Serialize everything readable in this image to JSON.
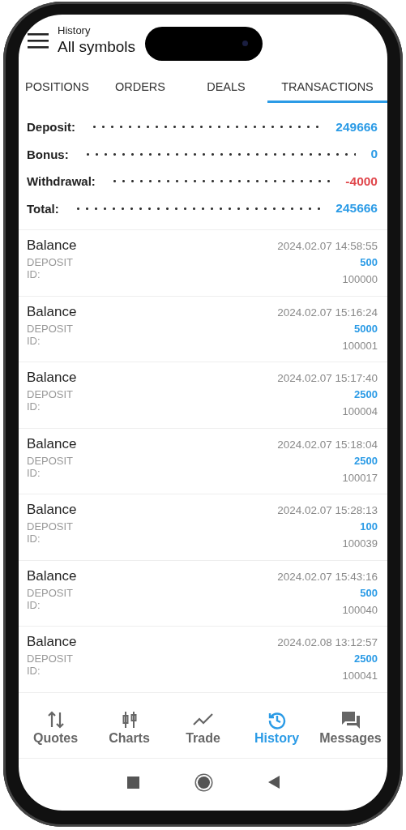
{
  "header": {
    "subtitle": "History",
    "title": "All symbols"
  },
  "tabs": [
    {
      "label": "POSITIONS",
      "selected": false
    },
    {
      "label": "ORDERS",
      "selected": false
    },
    {
      "label": "DEALS",
      "selected": false
    },
    {
      "label": "TRANSACTIONS",
      "selected": true
    }
  ],
  "summary": [
    {
      "label": "Deposit:",
      "value": "249666",
      "color": "#2b9be6"
    },
    {
      "label": "Bonus:",
      "value": "0",
      "color": "#2b9be6"
    },
    {
      "label": "Withdrawal:",
      "value": "-4000",
      "color": "#e0474c"
    },
    {
      "label": "Total:",
      "value": "245666",
      "color": "#2b9be6"
    }
  ],
  "transactions": [
    {
      "symbol": "Balance",
      "time": "2024.02.07 14:58:55",
      "type": "DEPOSIT",
      "amount": "500",
      "id_label": "ID:",
      "id": "100000"
    },
    {
      "symbol": "Balance",
      "time": "2024.02.07 15:16:24",
      "type": "DEPOSIT",
      "amount": "5000",
      "id_label": "ID:",
      "id": "100001"
    },
    {
      "symbol": "Balance",
      "time": "2024.02.07 15:17:40",
      "type": "DEPOSIT",
      "amount": "2500",
      "id_label": "ID:",
      "id": "100004"
    },
    {
      "symbol": "Balance",
      "time": "2024.02.07 15:18:04",
      "type": "DEPOSIT",
      "amount": "2500",
      "id_label": "ID:",
      "id": "100017"
    },
    {
      "symbol": "Balance",
      "time": "2024.02.07 15:28:13",
      "type": "DEPOSIT",
      "amount": "100",
      "id_label": "ID:",
      "id": "100039"
    },
    {
      "symbol": "Balance",
      "time": "2024.02.07 15:43:16",
      "type": "DEPOSIT",
      "amount": "500",
      "id_label": "ID:",
      "id": "100040"
    },
    {
      "symbol": "Balance",
      "time": "2024.02.08 13:12:57",
      "type": "DEPOSIT",
      "amount": "2500",
      "id_label": "ID:",
      "id": "100041"
    }
  ],
  "bottom_nav": [
    {
      "kind": "quotes",
      "label": "Quotes",
      "selected": false
    },
    {
      "kind": "charts",
      "label": "Charts",
      "selected": false
    },
    {
      "kind": "trade",
      "label": "Trade",
      "selected": false
    },
    {
      "kind": "history",
      "label": "History",
      "selected": true
    },
    {
      "kind": "messages",
      "label": "Messages",
      "selected": false
    }
  ]
}
